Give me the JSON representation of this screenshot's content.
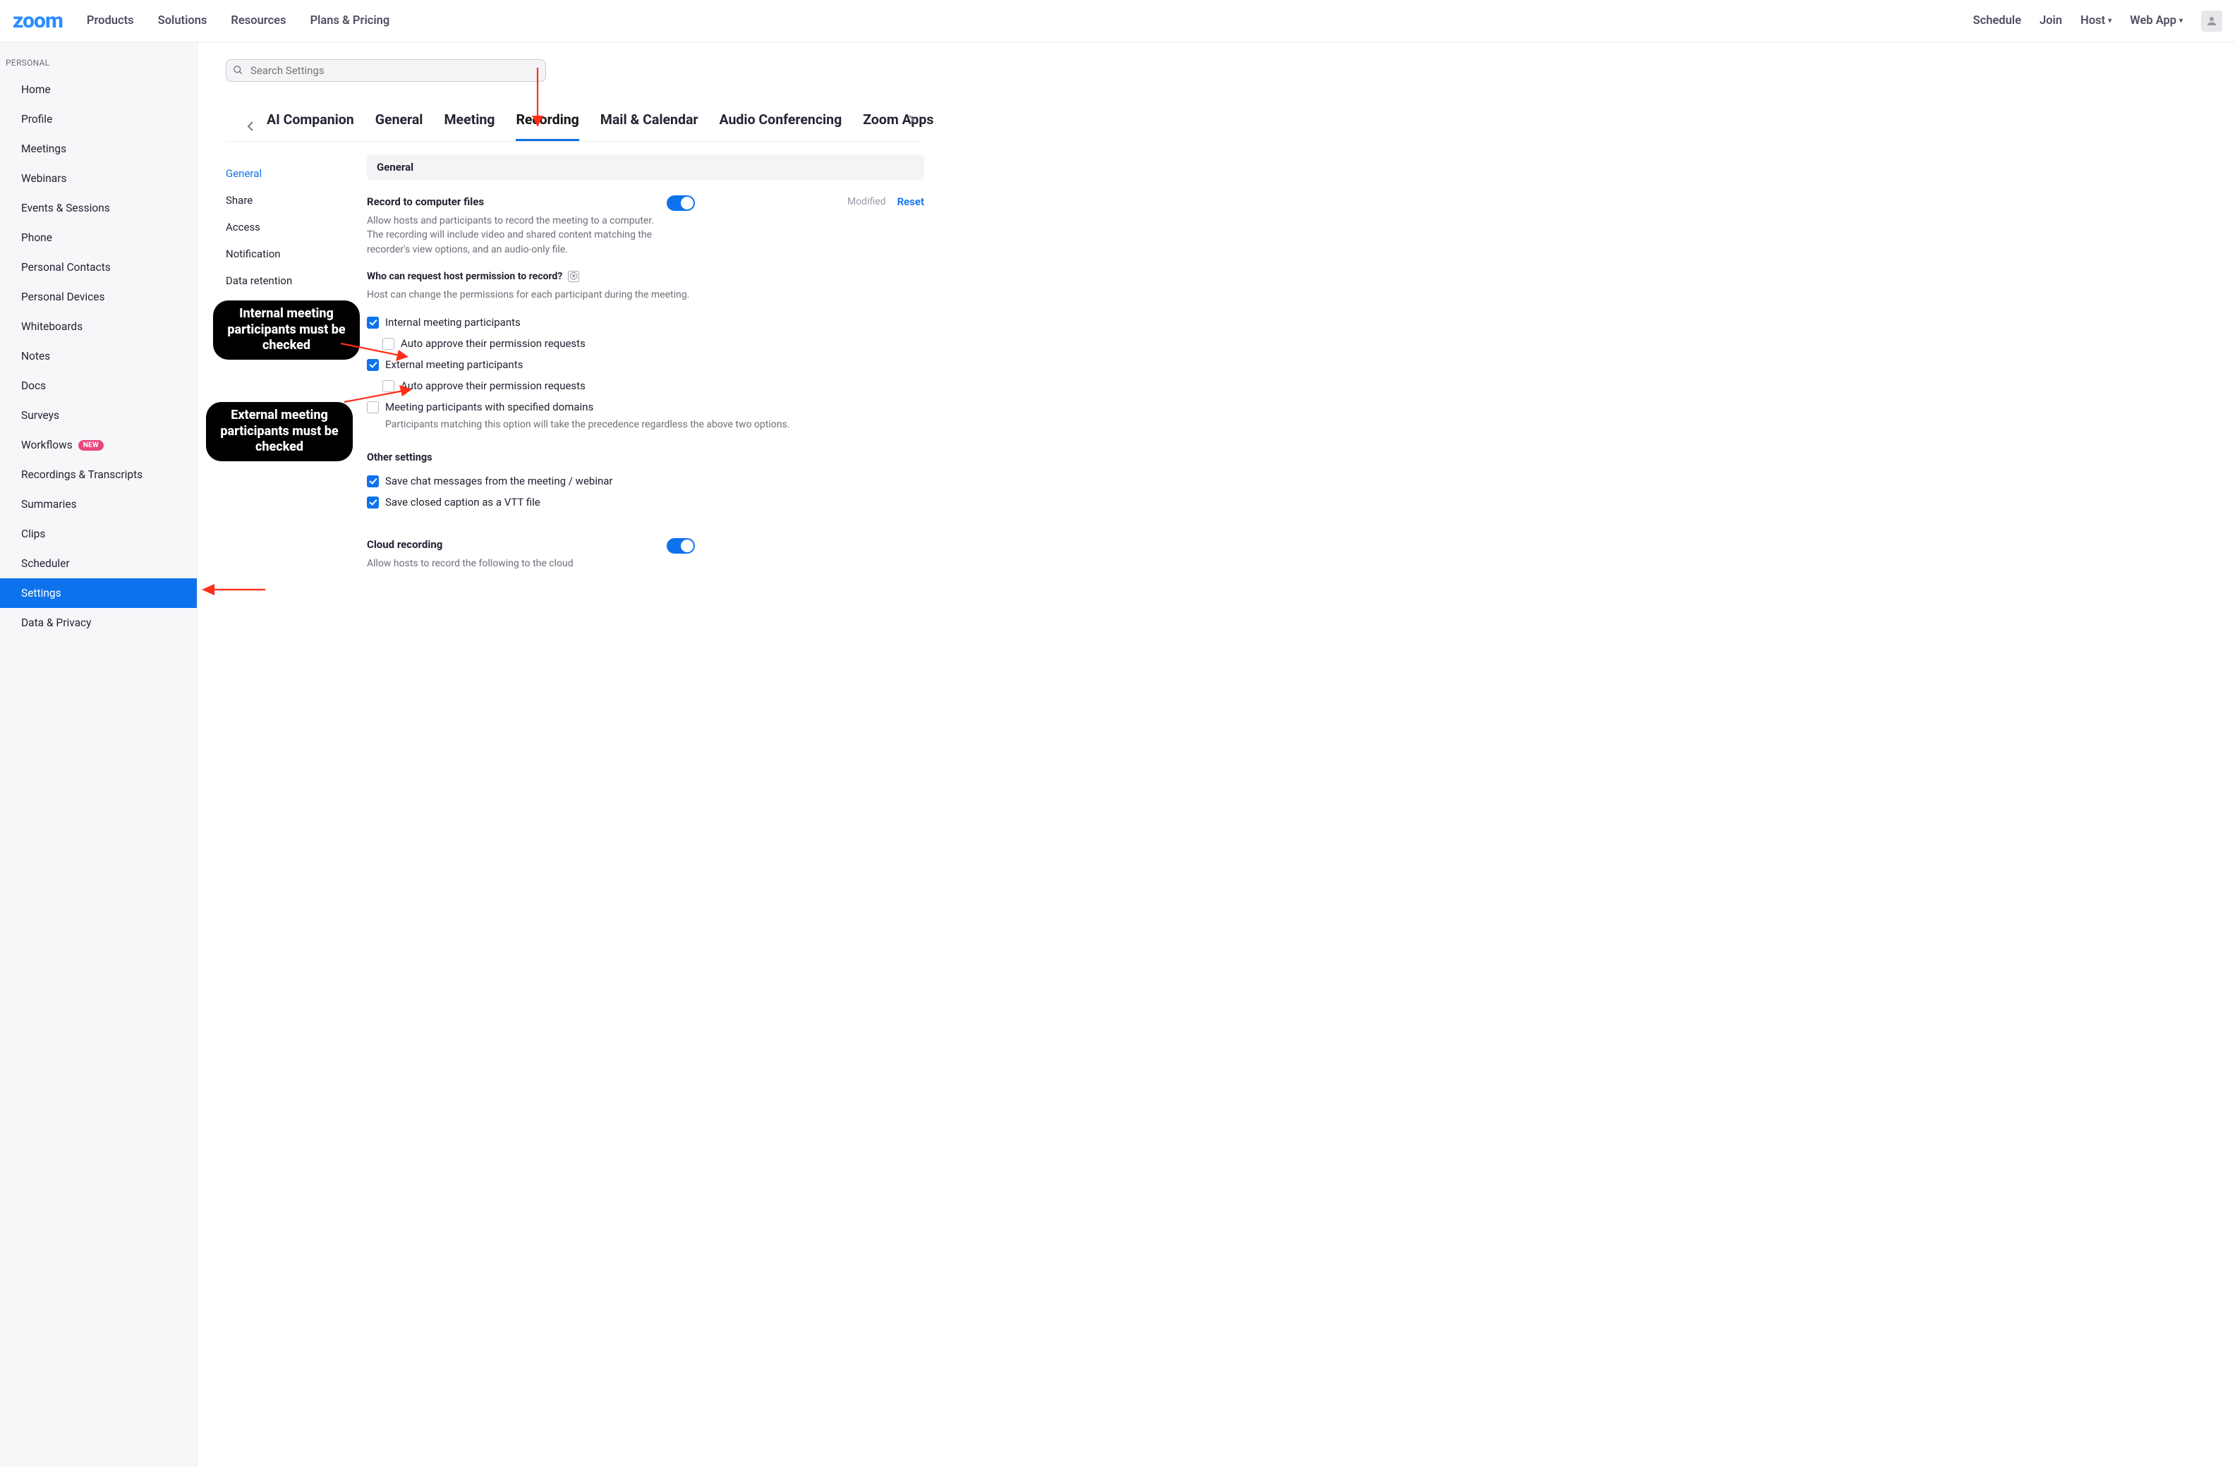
{
  "topnav": {
    "logo": "zoom",
    "left": [
      "Products",
      "Solutions",
      "Resources",
      "Plans & Pricing"
    ],
    "right": [
      {
        "label": "Schedule",
        "caret": false
      },
      {
        "label": "Join",
        "caret": false
      },
      {
        "label": "Host",
        "caret": true
      },
      {
        "label": "Web App",
        "caret": true
      }
    ]
  },
  "sidebar": {
    "section_label": "PERSONAL",
    "items": [
      {
        "label": "Home"
      },
      {
        "label": "Profile"
      },
      {
        "label": "Meetings"
      },
      {
        "label": "Webinars"
      },
      {
        "label": "Events & Sessions"
      },
      {
        "label": "Phone"
      },
      {
        "label": "Personal Contacts"
      },
      {
        "label": "Personal Devices"
      },
      {
        "label": "Whiteboards"
      },
      {
        "label": "Notes"
      },
      {
        "label": "Docs"
      },
      {
        "label": "Surveys"
      },
      {
        "label": "Workflows",
        "badge": "NEW"
      },
      {
        "label": "Recordings & Transcripts"
      },
      {
        "label": "Summaries"
      },
      {
        "label": "Clips"
      },
      {
        "label": "Scheduler"
      },
      {
        "label": "Settings",
        "selected": true
      },
      {
        "label": "Data & Privacy"
      }
    ]
  },
  "search": {
    "placeholder": "Search Settings"
  },
  "tabs": {
    "items": [
      "AI Companion",
      "General",
      "Meeting",
      "Recording",
      "Mail & Calendar",
      "Audio Conferencing",
      "Zoom Apps"
    ],
    "active": "Recording"
  },
  "subnav": [
    {
      "label": "General",
      "active": true
    },
    {
      "label": "Share"
    },
    {
      "label": "Access"
    },
    {
      "label": "Notification"
    },
    {
      "label": "Data retention"
    }
  ],
  "panel": {
    "group_header": "General",
    "record_local": {
      "title": "Record to computer files",
      "desc": "Allow hosts and participants to record the meeting to a computer. The recording will include video and shared content matching the recorder's view options, and an audio-only file.",
      "toggle": true,
      "modified_label": "Modified",
      "reset_label": "Reset"
    },
    "who_can_request": {
      "title": "Who can request host permission to record?",
      "desc": "Host can change the permissions for each participant during the meeting.",
      "help_badge": "ⓥ",
      "opts": {
        "internal": {
          "label": "Internal meeting participants",
          "checked": true
        },
        "internal_auto": {
          "label": "Auto approve their permission requests",
          "checked": false
        },
        "external": {
          "label": "External meeting participants",
          "checked": true
        },
        "external_auto": {
          "label": "Auto approve their permission requests",
          "checked": false
        },
        "domains": {
          "label": "Meeting participants with specified domains",
          "checked": false
        },
        "domains_desc": "Participants matching this option will take the precedence regardless the above two options."
      }
    },
    "other_settings": {
      "title": "Other settings",
      "save_chat": {
        "label": "Save chat messages from the meeting / webinar",
        "checked": true
      },
      "save_cc_vtt": {
        "label": "Save closed caption as a VTT file",
        "checked": true
      }
    },
    "cloud": {
      "title": "Cloud recording",
      "desc": "Allow hosts to record the following to the cloud",
      "toggle": true
    }
  },
  "annotations": {
    "bubble1": "Internal meeting\nparticipants must be\nchecked",
    "bubble2": "External meeting\nparticipants must be\nchecked"
  }
}
